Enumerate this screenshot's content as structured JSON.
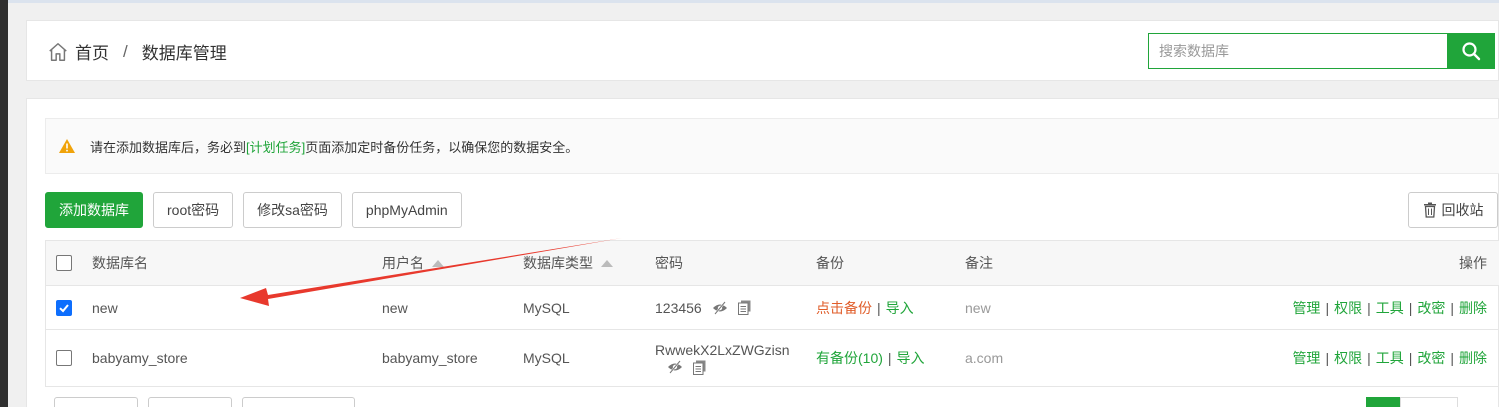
{
  "breadcrumb": {
    "home": "首页",
    "separator": "/",
    "current": "数据库管理"
  },
  "search": {
    "placeholder": "搜索数据库",
    "value": ""
  },
  "notice": {
    "prefix": "请在添加数据库后，务必到",
    "link": "[计划任务]",
    "suffix": "页面添加定时备份任务，以确保您的数据安全。"
  },
  "toolbar": {
    "add": "添加数据库",
    "root_pw": "root密码",
    "sa_pw": "修改sa密码",
    "phpmyadmin": "phpMyAdmin",
    "recycle": "回收站"
  },
  "table": {
    "columns": {
      "name": "数据库名",
      "user": "用户名",
      "type": "数据库类型",
      "password": "密码",
      "backup": "备份",
      "note": "备注",
      "ops": "操作"
    },
    "rows": [
      {
        "checked": true,
        "name": "new",
        "user": "new",
        "type": "MySQL",
        "password": "123456",
        "backup_status": "点击备份",
        "import": "导入",
        "note": "new"
      },
      {
        "checked": false,
        "name": "babyamy_store",
        "user": "babyamy_store",
        "type": "MySQL",
        "password": "RwwekX2LxZWGzisn",
        "backup_status": "有备份(10)",
        "import": "导入",
        "note": "a.com"
      }
    ],
    "actions": [
      "管理",
      "权限",
      "工具",
      "改密",
      "删除"
    ]
  },
  "colors": {
    "accent": "#20a53a",
    "warning": "#f0a30a",
    "backup_link": "#e05d2a",
    "annotation_arrow": "#e8392d",
    "checkbox": "#0d6efd"
  },
  "icons": [
    "home-icon",
    "search-icon",
    "warning-icon",
    "trash-icon",
    "eye-hidden-icon",
    "copy-icon",
    "checkmark-icon",
    "annotation-arrow"
  ]
}
